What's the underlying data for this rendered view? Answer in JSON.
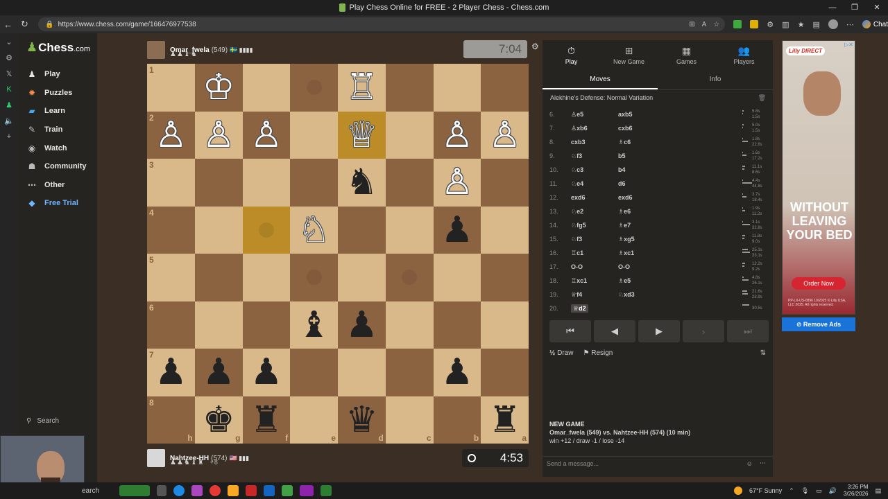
{
  "window": {
    "title": "Play Chess Online for FREE - 2 Player Chess - Chess.com",
    "controls": [
      "—",
      "❐",
      "✕"
    ]
  },
  "browser": {
    "url": "https://www.chess.com/game/166476977538",
    "copilot_label": "Chat"
  },
  "sidebar": {
    "logo_main": "Chess",
    "logo_suffix": ".com",
    "items": [
      {
        "label": "Play",
        "icon": "play-icon",
        "color": "#e8e6e3"
      },
      {
        "label": "Puzzles",
        "icon": "puzzle-icon",
        "color": "#f08a4b"
      },
      {
        "label": "Learn",
        "icon": "learn-icon",
        "color": "#3fa9f5"
      },
      {
        "label": "Train",
        "icon": "train-icon",
        "color": "#bbbbbb"
      },
      {
        "label": "Watch",
        "icon": "binoculars-icon",
        "color": "#bbbbbb"
      },
      {
        "label": "Community",
        "icon": "community-icon",
        "color": "#bbbbbb"
      },
      {
        "label": "Other",
        "icon": "more-icon",
        "color": "#bbbbbb"
      },
      {
        "label": "Free Trial",
        "icon": "diamond-icon",
        "color": "#6fb5ff"
      }
    ],
    "search_label": "Search"
  },
  "top_player": {
    "name": "Omar_fwela",
    "rating": "(549)",
    "flag": "🇸🇪 ▮▮▮▮",
    "captured": "♟♟♝♞",
    "clock": "7:04"
  },
  "bottom_player": {
    "name": "Nahtzee-HH",
    "rating": "(574)",
    "flag": "🇺🇸 ▮▮▮",
    "captured": "♟♟♞♝♜",
    "advantage": "+8",
    "clock": "4:53"
  },
  "board": {
    "ranks": [
      "1",
      "2",
      "3",
      "4",
      "5",
      "6",
      "7",
      "8"
    ],
    "files": [
      "h",
      "g",
      "f",
      "e",
      "d",
      "c",
      "b",
      "a"
    ],
    "light_color": "#d9b889",
    "dark_color": "#8c6340",
    "highlight_color": "#bb8c28",
    "highlights": [
      "d2",
      "f4"
    ],
    "pieces": [
      {
        "sq": "g1",
        "piece": "♔",
        "side": "w"
      },
      {
        "sq": "d1",
        "piece": "♖",
        "side": "w"
      },
      {
        "sq": "h2",
        "piece": "♙",
        "side": "w"
      },
      {
        "sq": "g2",
        "piece": "♙",
        "side": "w"
      },
      {
        "sq": "f2",
        "piece": "♙",
        "side": "w"
      },
      {
        "sq": "d2",
        "piece": "♕",
        "side": "w"
      },
      {
        "sq": "b2",
        "piece": "♙",
        "side": "w"
      },
      {
        "sq": "a2",
        "piece": "♙",
        "side": "w"
      },
      {
        "sq": "d3",
        "piece": "♞",
        "side": "b"
      },
      {
        "sq": "b3",
        "piece": "♙",
        "side": "w"
      },
      {
        "sq": "e4",
        "piece": "♘",
        "side": "w"
      },
      {
        "sq": "b4",
        "piece": "♟",
        "side": "b"
      },
      {
        "sq": "e6",
        "piece": "♝",
        "side": "b"
      },
      {
        "sq": "d6",
        "piece": "♟",
        "side": "b"
      },
      {
        "sq": "h7",
        "piece": "♟",
        "side": "b"
      },
      {
        "sq": "g7",
        "piece": "♟",
        "side": "b"
      },
      {
        "sq": "f7",
        "piece": "♟",
        "side": "b"
      },
      {
        "sq": "b7",
        "piece": "♟",
        "side": "b"
      },
      {
        "sq": "g8",
        "piece": "♚",
        "side": "b"
      },
      {
        "sq": "f8",
        "piece": "♜",
        "side": "b"
      },
      {
        "sq": "d8",
        "piece": "♛",
        "side": "b"
      },
      {
        "sq": "a8",
        "piece": "♜",
        "side": "b"
      }
    ],
    "ghost_dots": [
      "e1",
      "f4",
      "e5",
      "c5"
    ]
  },
  "panel": {
    "tabs": [
      {
        "label": "Play",
        "icon": "stopwatch-icon",
        "active": true
      },
      {
        "label": "New Game",
        "icon": "plus-icon",
        "active": false
      },
      {
        "label": "Games",
        "icon": "board-icon",
        "active": false
      },
      {
        "label": "Players",
        "icon": "players-icon",
        "active": false
      }
    ],
    "subtabs": [
      {
        "label": "Moves",
        "active": true
      },
      {
        "label": "Info",
        "active": false
      }
    ],
    "opening": "Alekhine's Defense: Normal Variation",
    "moves": [
      {
        "n": "6.",
        "w": "♙e5",
        "b": "axb5",
        "t1": "5.8s",
        "t2": "1.5s"
      },
      {
        "n": "7.",
        "w": "♙xb6",
        "b": "cxb6",
        "t1": "5.0s",
        "t2": "1.5s"
      },
      {
        "n": "8.",
        "w": "cxb3",
        "b": "♗c6",
        "t1": "1.8s",
        "t2": "22.6s"
      },
      {
        "n": "9.",
        "w": "♘f3",
        "b": "b5",
        "t1": "1.6s",
        "t2": "17.2s"
      },
      {
        "n": "10.",
        "w": "♘c3",
        "b": "b4",
        "t1": "11.1s",
        "t2": "8.6s"
      },
      {
        "n": "11.",
        "w": "♘e4",
        "b": "d6",
        "t1": "4.4s",
        "t2": "44.8s"
      },
      {
        "n": "12.",
        "w": "exd6",
        "b": "exd6",
        "t1": "3.7s",
        "t2": "18.4s"
      },
      {
        "n": "13.",
        "w": "♘e2",
        "b": "♗e6",
        "t1": "1.9s",
        "t2": "11.2s"
      },
      {
        "n": "14.",
        "w": "♘fg5",
        "b": "♗e7",
        "t1": "3.1s",
        "t2": "32.8s"
      },
      {
        "n": "15.",
        "w": "♘f3",
        "b": "♗xg5",
        "t1": "11.8s",
        "t2": "9.0s"
      },
      {
        "n": "16.",
        "w": "♖c1",
        "b": "♗xc1",
        "t1": "25.1s",
        "t2": "33.1s"
      },
      {
        "n": "17.",
        "w": "O-O",
        "b": "O-O",
        "t1": "12.2s",
        "t2": "9.2s"
      },
      {
        "n": "18.",
        "w": "♖xc1",
        "b": "♗e5",
        "t1": "4.8s",
        "t2": "26.1s"
      },
      {
        "n": "19.",
        "w": "♕f4",
        "b": "♘xd3",
        "t1": "21.6s",
        "t2": "23.9s"
      },
      {
        "n": "20.",
        "w": "♕d2",
        "b": "",
        "t1": "30.5s",
        "t2": "",
        "current": true
      }
    ],
    "controls": [
      "⏮",
      "◀",
      "▶",
      "›",
      "⏭"
    ],
    "draw_label": "Draw",
    "draw_icon": "½",
    "resign_label": "Resign",
    "new_game_heading": "NEW GAME",
    "new_game_matchup": "Omar_fwela (549) vs. Nahtzee-HH (574) (10 min)",
    "new_game_stats": "win +12 / draw -1 / lose -14",
    "message_placeholder": "Send a message..."
  },
  "ad": {
    "brand": "Lilly",
    "brand_suffix": "DIRECT",
    "headline": "WITHOUT LEAVING YOUR BED",
    "cta": "Order Now",
    "fine_print": "PP-LX-US-0896 10/2025 © Lilly USA, LLC 2025. All rights reserved.",
    "remove_label": "Remove Ads"
  },
  "taskbar": {
    "search_label": "earch",
    "weather": "67°F  Sunny",
    "time": "3:26 PM",
    "date": "3/26/2026"
  }
}
